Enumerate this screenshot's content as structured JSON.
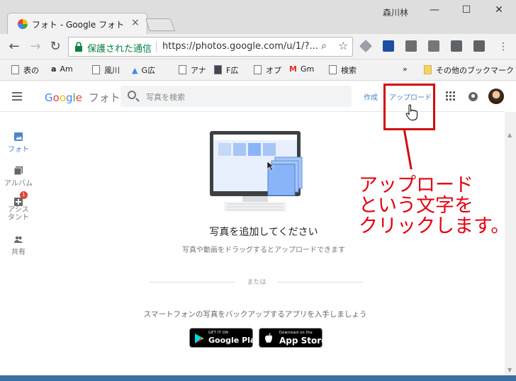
{
  "browser": {
    "tab_title": "フォト - Google フォト",
    "tab_close": "×",
    "user": "森川林",
    "window_min": "—",
    "window_max": "☐",
    "window_close": "✕",
    "secure_label": "保護された通信",
    "url": "https://photos.google.com/u/1/?..."
  },
  "bookmarks": [
    {
      "label": "表の"
    },
    {
      "label": "Am"
    },
    {
      "label": "風川"
    },
    {
      "label": "G広"
    },
    {
      "label": "アナ"
    },
    {
      "label": "F広"
    },
    {
      "label": "オプ"
    },
    {
      "label": "Gm"
    },
    {
      "label": "検索"
    }
  ],
  "bookmarks_more": "»",
  "bookmarks_other": "その他のブックマーク",
  "photos": {
    "logo_google": "Google",
    "logo_photos": "フォト",
    "search_placeholder": "写真を検索",
    "create_label": "作成",
    "upload_label": "アップロード"
  },
  "nav": {
    "photos": "フォト",
    "albums": "アルバム",
    "assistant": "アシスタント",
    "assistant_badge": "1",
    "sharing": "共有"
  },
  "main": {
    "title": "写真を追加してください",
    "subtitle": "写真や動画をドラッグするとアップロードできます",
    "or": "または",
    "app_promo": "スマートフォンの写真をバックアップするアプリを入手しましょう",
    "google_play_small": "GET IT ON",
    "google_play_big": "Google Play",
    "app_store_small": "Download on the",
    "app_store_big": "App Store"
  },
  "annotation": {
    "line1": "アップロード",
    "line2": "という文字を",
    "line3": "クリックします。"
  },
  "colors": {
    "accent_blue": "#4a86c9",
    "annotation_red": "#e3000f",
    "secure_green": "#0b8043"
  }
}
